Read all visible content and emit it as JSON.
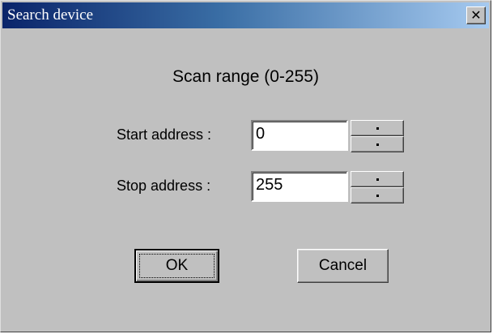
{
  "window": {
    "title": "Search device",
    "close_symbol": "✕"
  },
  "dialog": {
    "heading": "Scan range (0-255)",
    "start_label": "Start address :",
    "start_value": "0",
    "stop_label": "Stop address :",
    "stop_value": "255",
    "ok_label": "OK",
    "cancel_label": "Cancel"
  },
  "icons": {
    "close": "close-icon",
    "spin_up": "up-arrow-icon",
    "spin_down": "down-arrow-icon"
  }
}
